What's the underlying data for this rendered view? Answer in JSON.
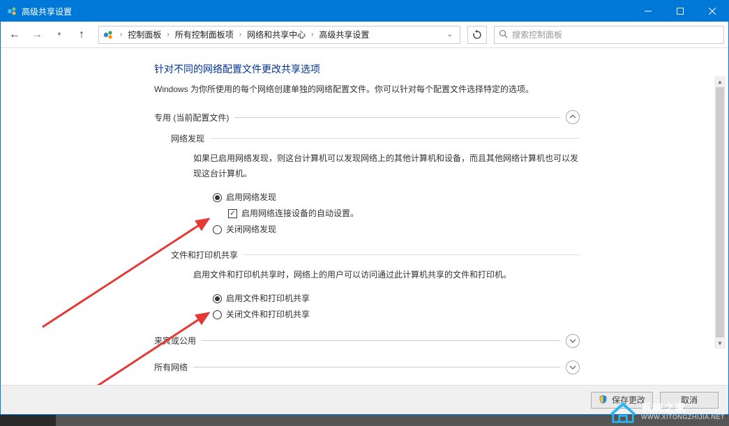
{
  "window": {
    "title": "高级共享设置"
  },
  "nav": {
    "breadcrumb": [
      "控制面板",
      "所有控制面板项",
      "网络和共享中心",
      "高级共享设置"
    ],
    "search_placeholder": "搜索控制面板"
  },
  "page": {
    "title": "针对不同的网络配置文件更改共享选项",
    "desc": "Windows 为你所使用的每个网络创建单独的网络配置文件。你可以针对每个配置文件选择特定的选项。"
  },
  "sections": {
    "private": {
      "header": "专用 (当前配置文件)",
      "expanded": true,
      "network_discovery": {
        "title": "网络发现",
        "desc": "如果已启用网络发现，则这台计算机可以发现网络上的其他计算机和设备，而且其他网络计算机也可以发现这台计算机。",
        "options": {
          "enable": "启用网络发现",
          "auto_setup": "启用网络连接设备的自动设置。",
          "disable": "关闭网络发现"
        },
        "selected": "enable",
        "auto_checked": true
      },
      "file_printer": {
        "title": "文件和打印机共享",
        "desc": "启用文件和打印机共享时，网络上的用户可以访问通过此计算机共享的文件和打印机。",
        "options": {
          "enable": "启用文件和打印机共享",
          "disable": "关闭文件和打印机共享"
        },
        "selected": "enable"
      }
    },
    "guest": {
      "header": "来宾或公用",
      "expanded": false
    },
    "all": {
      "header": "所有网络",
      "expanded": false
    }
  },
  "footer": {
    "save": "保存更改",
    "cancel": "取消"
  },
  "watermark": {
    "cn": "系统之家",
    "en": "WWW.XITONGZHIJIA.NET"
  }
}
